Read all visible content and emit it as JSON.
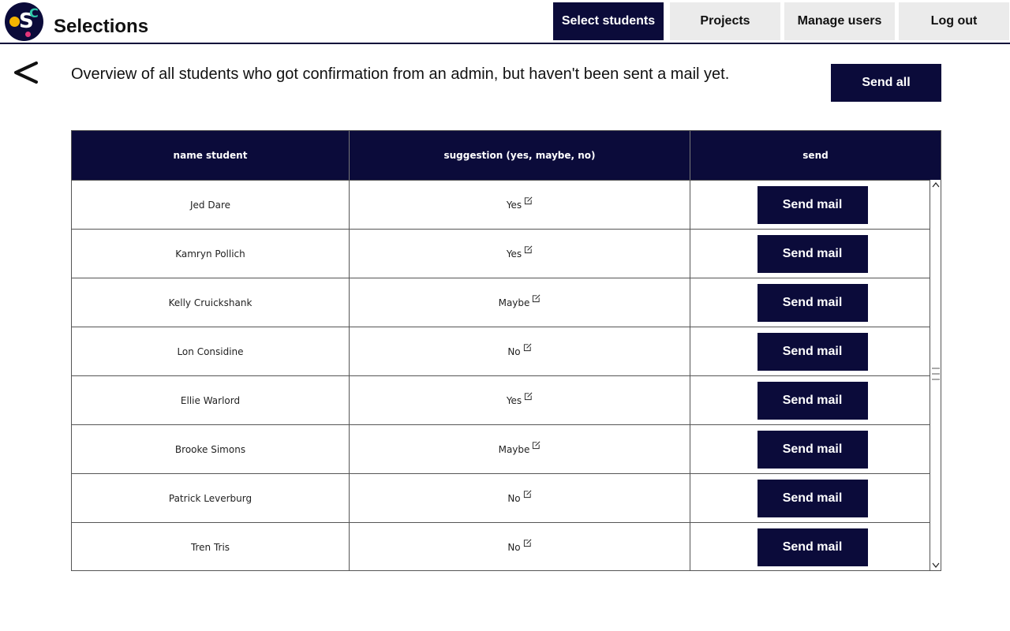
{
  "header": {
    "app_title": "Selections",
    "nav": [
      {
        "label": "Select students",
        "active": true
      },
      {
        "label": "Projects",
        "active": false
      },
      {
        "label": "Manage users",
        "active": false
      },
      {
        "label": "Log out",
        "active": false
      }
    ]
  },
  "page": {
    "back_icon": "chevron-left-icon",
    "intro": "Overview of all students who got confirmation from an admin, but haven't been sent a mail yet.",
    "send_all_label": "Send all"
  },
  "table": {
    "columns": [
      "name student",
      "suggestion (yes, maybe, no)",
      "send"
    ],
    "rows": [
      {
        "name": "Jed Dare",
        "suggestion": "Yes",
        "action": "Send mail"
      },
      {
        "name": "Kamryn Pollich",
        "suggestion": "Yes",
        "action": "Send mail"
      },
      {
        "name": "Kelly Cruickshank",
        "suggestion": "Maybe",
        "action": "Send mail"
      },
      {
        "name": "Lon Considine",
        "suggestion": "No",
        "action": "Send mail"
      },
      {
        "name": "Ellie Warlord",
        "suggestion": "Yes",
        "action": "Send mail"
      },
      {
        "name": "Brooke Simons",
        "suggestion": "Maybe",
        "action": "Send mail"
      },
      {
        "name": "Patrick Leverburg",
        "suggestion": "No",
        "action": "Send mail"
      },
      {
        "name": "Tren Tris",
        "suggestion": "No",
        "action": "Send mail"
      }
    ]
  },
  "colors": {
    "brand_navy": "#0b0b3a",
    "nav_inactive": "#ebebeb",
    "logo_yellow": "#f5b400",
    "logo_teal": "#2fc6a9",
    "logo_pink": "#e2357a"
  }
}
